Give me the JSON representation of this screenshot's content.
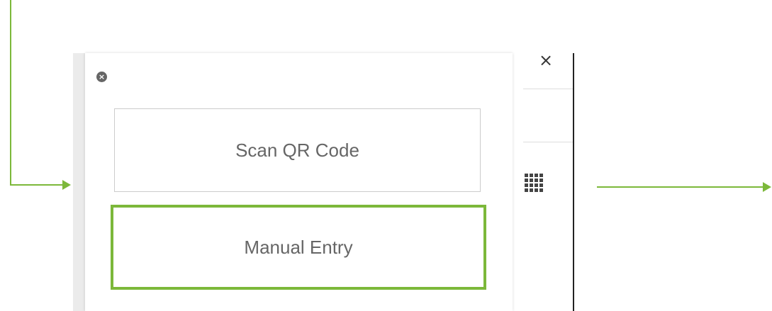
{
  "dialog": {
    "close_icon": "close-circle-icon",
    "options": [
      {
        "label": "Scan QR Code",
        "selected": false
      },
      {
        "label": "Manual Entry",
        "selected": true
      }
    ]
  },
  "background": {
    "close_glyph": "×",
    "grid_icon": "grid-icon"
  },
  "colors": {
    "highlight": "#7cb83a",
    "button_text": "#666666",
    "border": "#cccccc"
  }
}
